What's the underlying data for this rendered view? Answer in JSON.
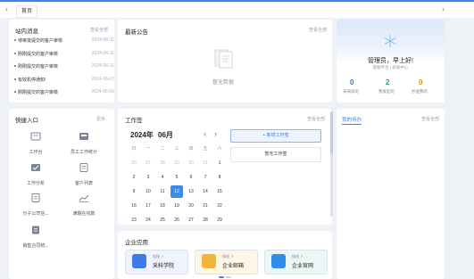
{
  "topbar": {
    "back_arrow": "‹",
    "forward_arrow": "›",
    "home_tab": "首页"
  },
  "notices": {
    "title": "站内消息",
    "more": "查看全部",
    "items": [
      {
        "text": "待审批提交的客户审核",
        "date": "2024-06-11"
      },
      {
        "text": "刚刚提交的客户审核",
        "date": "2024-06-11"
      },
      {
        "text": "刚刚提交的客户审核",
        "date": "2024-06-11"
      },
      {
        "text": "有效机停通知!",
        "date": "2024-06-07"
      },
      {
        "text": "刚刚提交的客户审核",
        "date": "2024-06-06"
      }
    ]
  },
  "announcement": {
    "title": "最新公告",
    "more": "查看全部",
    "empty": "暂无数据"
  },
  "profile": {
    "greeting": "管理员，早上好!",
    "sub": "客服平台 | 研发中心",
    "stats": [
      {
        "num": "0",
        "label": "未阅读的",
        "color": "#2f6fd6"
      },
      {
        "num": "2",
        "label": "我发起的",
        "color": "#27a35a"
      },
      {
        "num": "0",
        "label": "抄送我的",
        "color": "#e8891a"
      }
    ]
  },
  "quick": {
    "title": "快捷入口",
    "more": "更多",
    "items": [
      {
        "label": "工作台",
        "icon": "desk-icon"
      },
      {
        "label": "员工工作统计",
        "icon": "stats-icon"
      },
      {
        "label": "工作分析",
        "icon": "check-icon"
      },
      {
        "label": "客户列表",
        "icon": "list-icon"
      },
      {
        "label": "分子公司信...",
        "icon": "doc-icon"
      },
      {
        "label": "满期在线数",
        "icon": "chart-icon"
      },
      {
        "label": "销售合同统...",
        "icon": "file-icon"
      }
    ]
  },
  "worklog": {
    "title": "工作签",
    "more": "查看全部",
    "year": "2024年",
    "month": "06月",
    "weekdays": [
      "日",
      "一",
      "二",
      "三",
      "四",
      "五",
      "六"
    ],
    "days": [
      [
        "26",
        "27",
        "28",
        "29",
        "30",
        "31",
        "1"
      ],
      [
        "2",
        "3",
        "4",
        "5",
        "6",
        "7",
        "8"
      ],
      [
        "9",
        "10",
        "11",
        "12",
        "13",
        "14",
        "15"
      ],
      [
        "16",
        "17",
        "18",
        "19",
        "20",
        "21",
        "22"
      ],
      [
        "23",
        "24",
        "25",
        "26",
        "27",
        "28",
        "29"
      ]
    ],
    "selected": "12",
    "add_button": "+ 新增工作签",
    "empty_button": "暂无工作签"
  },
  "my_todo": {
    "title": "我的待办",
    "more": "查看全部"
  },
  "apps": {
    "title": "企业应用",
    "items": [
      {
        "tag": "链接 ↗",
        "name": "采科学院",
        "bg": "#eef3fd",
        "icon_color": "#3d7bea"
      },
      {
        "tag": "链接 ↗",
        "name": "企业邮箱",
        "bg": "#fdf6e6",
        "icon_color": "#f3b43a"
      },
      {
        "tag": "链接 ↗",
        "name": "企业官网",
        "bg": "#eaf7f4",
        "icon_color": "#2e8fe8"
      }
    ]
  },
  "colors": {
    "accent": "#3c82f6",
    "selected_day": "#3c8cf0"
  }
}
